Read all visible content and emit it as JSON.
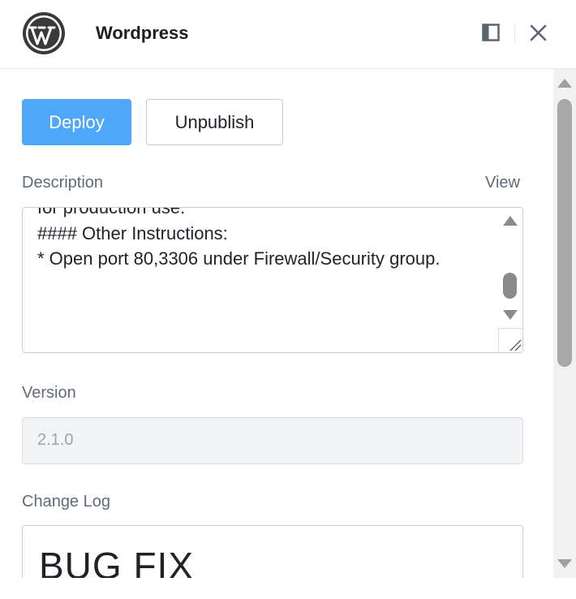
{
  "header": {
    "app_title": "Wordpress",
    "logo_icon": "wordpress-logo-icon",
    "panel_icon": "panel-toggle-icon",
    "close_icon": "close-icon"
  },
  "actions": {
    "deploy_label": "Deploy",
    "unpublish_label": "Unpublish"
  },
  "description": {
    "label": "Description",
    "view_link": "View",
    "text": "for production use.\n#### Other Instructions:\n* Open port 80,3306 under Firewall/Security group."
  },
  "version": {
    "label": "Version",
    "value": "2.1.0"
  },
  "changelog": {
    "label": "Change Log",
    "value": "BUG FIX"
  },
  "colors": {
    "accent": "#4fa7f9",
    "muted_label": "#5f6b7a"
  }
}
